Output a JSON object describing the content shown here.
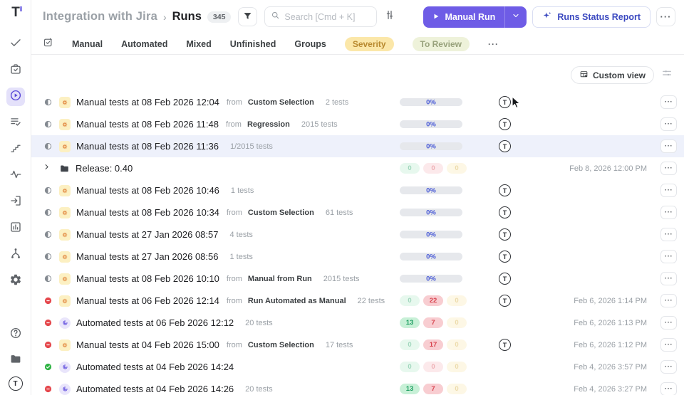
{
  "labels": {
    "from": "from",
    "menu": "···",
    "avatar": "T",
    "logo": "T"
  },
  "sidebar": {
    "items": [
      {
        "icon": "check-icon",
        "active": false
      },
      {
        "icon": "tasks-icon",
        "active": false
      },
      {
        "icon": "runs-icon",
        "active": true
      },
      {
        "icon": "test-plans-icon",
        "active": false
      },
      {
        "icon": "steps-icon",
        "active": false
      },
      {
        "icon": "pulse-icon",
        "active": false
      },
      {
        "icon": "import-icon",
        "active": false
      },
      {
        "icon": "analytics-icon",
        "active": false
      },
      {
        "icon": "branch-icon",
        "active": false
      },
      {
        "icon": "settings-icon",
        "active": false
      }
    ],
    "bottom_icons": [
      "help-icon",
      "projects-icon"
    ]
  },
  "header": {
    "project": "Integration with Jira",
    "chevron": "›",
    "page": "Runs",
    "runs_count": "345",
    "search_placeholder": "Search [Cmd + K]",
    "manual_run": "Manual Run",
    "runs_status_report": "Runs Status Report",
    "more": "···"
  },
  "tabs": {
    "items": [
      "Manual",
      "Automated",
      "Mixed",
      "Unfinished",
      "Groups"
    ],
    "pills": [
      {
        "label": "Severity",
        "style": "amber"
      },
      {
        "label": "To Review",
        "style": "green"
      }
    ],
    "more": "···"
  },
  "toolbar": {
    "custom_view": "Custom view"
  },
  "rows": [
    {
      "status": "in-progress",
      "type": "manual",
      "title": "Manual tests at 08 Feb 2026 12:04",
      "from": "Custom Selection",
      "tests": "2 tests",
      "progress": "0%",
      "avatar": true,
      "date": "",
      "highlighted": false
    },
    {
      "status": "in-progress",
      "type": "manual",
      "title": "Manual tests at 08 Feb 2026 11:48",
      "from": "Regression",
      "tests": "2015 tests",
      "progress": "0%",
      "avatar": true,
      "date": "",
      "highlighted": false
    },
    {
      "status": "in-progress",
      "type": "manual",
      "title": "Manual tests at 08 Feb 2026 11:36",
      "from": "",
      "tests": "1/2015 tests",
      "progress": "0%",
      "avatar": true,
      "date": "",
      "highlighted": true
    },
    {
      "status": "",
      "type": "group",
      "title": "Release: 0.40",
      "from": "",
      "tests": "",
      "badges": [
        "0",
        "0",
        "0"
      ],
      "avatar": false,
      "date": "Feb 8, 2026 12:00 PM",
      "highlighted": false
    },
    {
      "status": "in-progress",
      "type": "manual",
      "title": "Manual tests at 08 Feb 2026 10:46",
      "from": "",
      "tests": "1 tests",
      "progress": "0%",
      "avatar": true,
      "date": "",
      "highlighted": false
    },
    {
      "status": "in-progress",
      "type": "manual",
      "title": "Manual tests at 08 Feb 2026 10:34",
      "from": "Custom Selection",
      "tests": "61 tests",
      "progress": "0%",
      "avatar": true,
      "date": "",
      "highlighted": false
    },
    {
      "status": "in-progress",
      "type": "manual",
      "title": "Manual tests at 27 Jan 2026 08:57",
      "from": "",
      "tests": "4 tests",
      "progress": "0%",
      "avatar": true,
      "date": "",
      "highlighted": false
    },
    {
      "status": "in-progress",
      "type": "manual",
      "title": "Manual tests at 27 Jan 2026 08:56",
      "from": "",
      "tests": "1 tests",
      "progress": "0%",
      "avatar": true,
      "date": "",
      "highlighted": false
    },
    {
      "status": "in-progress",
      "type": "manual",
      "title": "Manual tests at 08 Feb 2026 10:10",
      "from": "Manual from Run",
      "tests": "2015 tests",
      "progress": "0%",
      "avatar": true,
      "date": "",
      "highlighted": false
    },
    {
      "status": "failed",
      "type": "manual",
      "title": "Manual tests at 06 Feb 2026 12:14",
      "from": "Run Automated as Manual",
      "tests": "22 tests",
      "badges": [
        "0",
        "22",
        "0"
      ],
      "avatar": true,
      "date": "Feb 6, 2026 1:14 PM",
      "highlighted": false
    },
    {
      "status": "failed",
      "type": "automated",
      "title": "Automated tests at 06 Feb 2026 12:12",
      "from": "",
      "tests": "20 tests",
      "badges": [
        "13",
        "7",
        "0"
      ],
      "avatar": false,
      "date": "Feb 6, 2026 1:13 PM",
      "highlighted": false
    },
    {
      "status": "failed",
      "type": "manual",
      "title": "Manual tests at 04 Feb 2026 15:00",
      "from": "Custom Selection",
      "tests": "17 tests",
      "badges": [
        "0",
        "17",
        "0"
      ],
      "avatar": true,
      "date": "Feb 6, 2026 1:12 PM",
      "highlighted": false
    },
    {
      "status": "passed",
      "type": "automated",
      "title": "Automated tests at 04 Feb 2026 14:24",
      "from": "",
      "tests": "",
      "badges": [
        "0",
        "0",
        "0"
      ],
      "avatar": false,
      "date": "Feb 4, 2026 3:57 PM",
      "highlighted": false
    },
    {
      "status": "failed",
      "type": "automated",
      "title": "Automated tests at 04 Feb 2026 14:26",
      "from": "",
      "tests": "20 tests",
      "badges": [
        "13",
        "7",
        "0"
      ],
      "avatar": false,
      "date": "Feb 4, 2026 3:27 PM",
      "highlighted": false
    }
  ],
  "colors": {
    "accent": "#6e5ce6",
    "row_highlight": "#eef1fb",
    "progress_text": "#4a5bd6",
    "pass_badge": "#c8f0d7",
    "fail_badge": "#f8cdd1",
    "skip_badge": "#fbeec3",
    "severity_pill": "#fbe7a9",
    "to_review_pill": "#eef2da"
  }
}
